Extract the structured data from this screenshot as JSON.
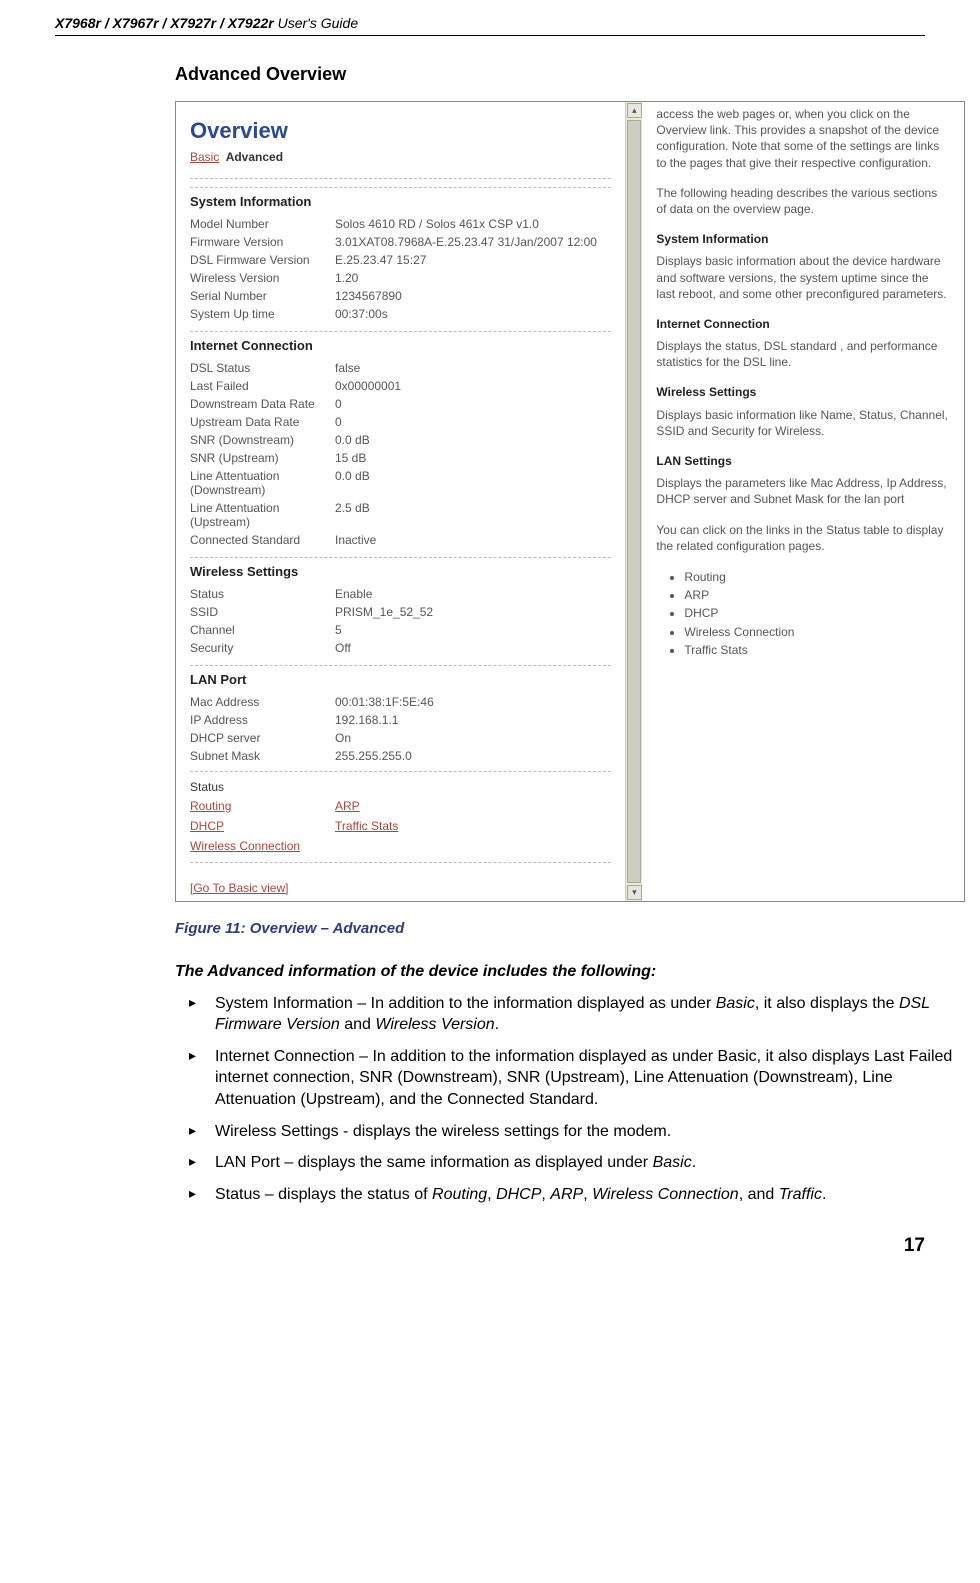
{
  "header": {
    "models": "X7968r / X7967r / X7927r / X7922r",
    "guide": " User's Guide"
  },
  "section_title": "Advanced Overview",
  "screenshot": {
    "overview_title": "Overview",
    "tabs": {
      "basic": "Basic",
      "advanced": "Advanced"
    },
    "sys_info": {
      "heading": "System Information",
      "rows": [
        {
          "label": "Model Number",
          "value": "Solos 4610 RD / Solos 461x CSP v1.0"
        },
        {
          "label": "Firmware Version",
          "value": "3.01XAT08.7968A-E.25.23.47 31/Jan/2007 12:00"
        },
        {
          "label": "DSL Firmware Version",
          "value": "E.25.23.47 15:27"
        },
        {
          "label": "Wireless Version",
          "value": "1.20"
        },
        {
          "label": "Serial Number",
          "value": "1234567890"
        },
        {
          "label": "System Up time",
          "value": "00:37:00s"
        }
      ]
    },
    "inet": {
      "heading": "Internet Connection",
      "rows": [
        {
          "label": "DSL Status",
          "value": "false"
        },
        {
          "label": "Last Failed",
          "value": "0x00000001"
        },
        {
          "label": "Downstream Data Rate",
          "value": "0"
        },
        {
          "label": "Upstream Data Rate",
          "value": "0"
        },
        {
          "label": "SNR (Downstream)",
          "value": "0.0 dB"
        },
        {
          "label": "SNR (Upstream)",
          "value": "15 dB"
        },
        {
          "label": "Line Attentuation (Downstream)",
          "value": "0.0 dB"
        },
        {
          "label": "Line Attentuation (Upstream)",
          "value": "2.5 dB"
        },
        {
          "label": "Connected Standard",
          "value": "Inactive"
        }
      ]
    },
    "wireless": {
      "heading": "Wireless Settings",
      "rows": [
        {
          "label": "Status",
          "value": "Enable"
        },
        {
          "label": "SSID",
          "value": "PRISM_1e_52_52"
        },
        {
          "label": "Channel",
          "value": "5"
        },
        {
          "label": "Security",
          "value": "Off"
        }
      ]
    },
    "lan": {
      "heading": "LAN Port",
      "rows": [
        {
          "label": "Mac Address",
          "value": "00:01:38:1F:5E:46"
        },
        {
          "label": "IP Address",
          "value": "192.168.1.1"
        },
        {
          "label": "DHCP server",
          "value": "On"
        },
        {
          "label": "Subnet Mask",
          "value": "255.255.255.0"
        }
      ]
    },
    "status": {
      "heading": "Status",
      "links": {
        "routing": "Routing",
        "arp": "ARP",
        "dhcp": "DHCP",
        "traffic": "Traffic Stats",
        "wireless": "Wireless Connection"
      }
    },
    "go_basic": "[Go To Basic view]",
    "right": {
      "p1": "access the web pages or, when you click on the Overview link. This provides a snapshot of the device configuration. Note that some of the settings are links to the pages that give their respective configuration.",
      "p2": "The following heading describes the various sections of data on the overview page.",
      "h1": "System Information",
      "p3": "Displays basic information about the device hardware and software versions, the system uptime since the last reboot, and some other preconfigured parameters.",
      "h2": "Internet Connection",
      "p4": "Displays the status, DSL standard , and performance statistics for the DSL line.",
      "h3": "Wireless Settings",
      "p5": "Displays basic information like Name, Status, Channel, SSID and Security for Wireless.",
      "h4": "LAN Settings",
      "p6": "Displays the parameters like Mac Address, Ip Address, DHCP server and Subnet Mask for the lan port",
      "p7": "You can click on the links in the Status table to display the related configuration pages.",
      "bullets": [
        "Routing",
        "ARP",
        "DHCP",
        "Wireless Connection",
        "Traffic Stats"
      ]
    }
  },
  "figure_caption": "Figure 11: Overview – Advanced",
  "body": {
    "lead": "The Advanced information of the device includes the following:",
    "items": [
      {
        "pre": "System Information – In addition to the information displayed as under ",
        "em1": "Basic",
        "mid": ", it also displays the ",
        "em2": "DSL Firmware Version",
        "mid2": " and ",
        "em3": "Wireless Version",
        "post": "."
      },
      {
        "text": "Internet Connection – In addition to the information displayed as under Basic, it also displays Last Failed internet connection, SNR (Downstream), SNR (Upstream), Line Attenuation (Downstream), Line Attenuation (Upstream), and the Connected Standard."
      },
      {
        "text": "Wireless Settings - displays the wireless settings for the modem."
      },
      {
        "pre": "LAN Port – displays the same information as displayed under ",
        "em1": "Basic",
        "post": "."
      },
      {
        "pre": "Status – displays the status of ",
        "em1": "Routing",
        "c1": ", ",
        "em2": "DHCP",
        "c2": ", ",
        "em3": "ARP",
        "c3": ", ",
        "em4": "Wireless Connection",
        "c4": ", and ",
        "em5": "Traffic",
        "post": "."
      }
    ]
  },
  "page_number": "17"
}
